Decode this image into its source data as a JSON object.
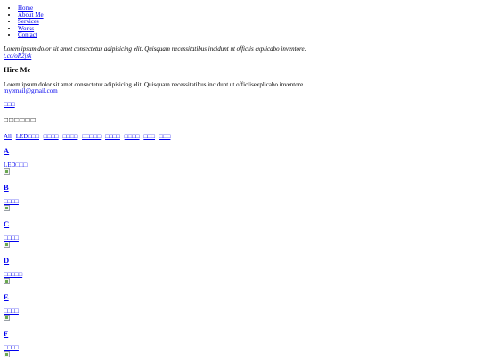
{
  "nav": {
    "items": [
      "Home",
      "About Me",
      "Services",
      "Works",
      "Contact"
    ]
  },
  "intro": {
    "text": "Lorem ipsum dolor sit amet consectetur adipisicing elit. Quisquam necessitatibus incidunt ut officiis explicabo inventore.",
    "shortlink": "t.co/oR2jsk"
  },
  "hire": {
    "title": "Hire Me",
    "text": "Lorem ipsum dolor sit amet consectetur adipisicing elit. Quisquam necessitatibus incidunt ut officiisexplicabo inventore.",
    "email": "myemail@gmail.com"
  },
  "small_link": "□□□",
  "gallery": {
    "title": "□□□□□□",
    "filters": [
      "All",
      "LED□□□",
      "□□□□",
      "□□□□",
      "□□□□□",
      "□□□□",
      "□□□□",
      "□□□",
      "□□□"
    ],
    "sections": [
      {
        "letter": "A",
        "category": "LED□□□"
      },
      {
        "letter": "B",
        "category": "□□□□"
      },
      {
        "letter": "C",
        "category": "□□□□"
      },
      {
        "letter": "D",
        "category": "□□□□□"
      },
      {
        "letter": "E",
        "category": "□□□□"
      },
      {
        "letter": "F",
        "category": "□□□□"
      }
    ]
  },
  "colors": {
    "link": "#0000ee",
    "text": "#000000",
    "background": "#ffffff"
  }
}
